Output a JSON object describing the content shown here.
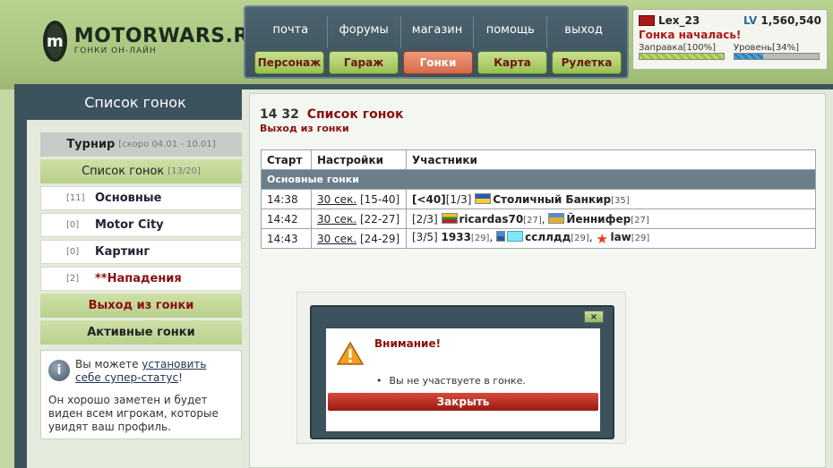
{
  "brand": {
    "logo_mark": "m",
    "title": "MOTORWARS.RU",
    "subtitle": "ГОНКИ ОН-ЛАЙН"
  },
  "nav": {
    "top": [
      "почта",
      "форумы",
      "магазин",
      "помощь",
      "выход"
    ],
    "bottom": [
      "Персонаж",
      "Гараж",
      "Гонки",
      "Карта",
      "Рулетка"
    ],
    "active": "Гонки"
  },
  "user": {
    "name": "Lex_23",
    "lv_label": "LV",
    "lv_value": "1,560,540",
    "race_status": "Гонка началась!",
    "fuel_label": "Заправка[100%]",
    "fuel_percent": 100,
    "level_label": "Уровень[34%]",
    "level_percent": 34
  },
  "sidebar": {
    "title": "Список гонок",
    "tournament_label": "Турнир",
    "tournament_note": "[скоро 04.01 - 10.01]",
    "race_list_label": "Список гонок",
    "race_list_count": "[13/20]",
    "items": [
      {
        "count": "[11]",
        "label": "Основные"
      },
      {
        "count": "[0]",
        "label": "Motor City"
      },
      {
        "count": "[0]",
        "label": "Картинг"
      },
      {
        "count": "[2]",
        "label": "**Нападения"
      }
    ],
    "leave_race": "Выход из гонки",
    "active_races": "Активные гонки",
    "info_pre": "Вы можете ",
    "info_link": "установить себе супер-статус",
    "info_post": "!",
    "info_body": "Он хорошо заметен и будет виден всем игрокам, которые увидят ваш профиль."
  },
  "content": {
    "time": "14 32",
    "title": "Список гонок",
    "subtitle": "Выход из гонки",
    "columns": [
      "Старт",
      "Настройки",
      "Участники"
    ],
    "section": "Основные гонки",
    "rows": [
      {
        "start": "14:38",
        "time_link": "30 сек.",
        "range": "[15-40]",
        "prefix": "[<40]",
        "slots": "[1/3]",
        "p1_name": "Столичный Банкир",
        "p1_level": "[35]"
      },
      {
        "start": "14:42",
        "time_link": "30 сек.",
        "range": "[22-27]",
        "slots": "[2/3]",
        "p1_name": "ricardas70",
        "p1_level": "[27]",
        "p2_name": "Йеннифер",
        "p2_level": "[27]"
      },
      {
        "start": "14:43",
        "time_link": "30 сек.",
        "range": "[24-29]",
        "slots": "[3/5]",
        "p1_name": "1933",
        "p1_level": "[29]",
        "p2_name": "ссллдд",
        "p2_level": "[29]",
        "p3_name": "law",
        "p3_level": "[29]"
      }
    ]
  },
  "modal": {
    "close": "×",
    "title": "Внимание!",
    "message": "Вы не участвуете в гонке.",
    "button": "Закрыть"
  }
}
